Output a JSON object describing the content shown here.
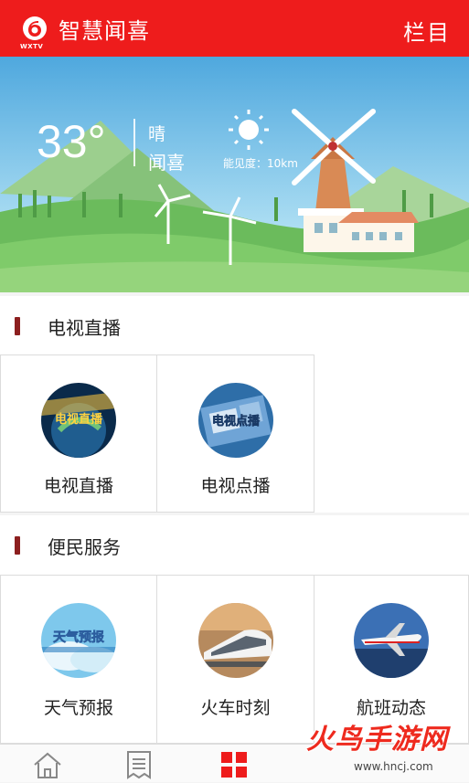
{
  "header": {
    "logo_caption": "WXTV",
    "title": "智慧闻喜",
    "menu_label": "栏目"
  },
  "weather": {
    "temperature": "33°",
    "condition": "晴",
    "city": "闻喜",
    "visibility": "能见度：10km"
  },
  "sections": [
    {
      "title": "电视直播",
      "tiles": [
        {
          "label": "电视直播",
          "icon_text": "电视直播",
          "icon": "tv-live-icon"
        },
        {
          "label": "电视点播",
          "icon_text": "电视点播",
          "icon": "tv-vod-icon"
        }
      ]
    },
    {
      "title": "便民服务",
      "tiles": [
        {
          "label": "天气预报",
          "icon_text": "天气预报",
          "icon": "weather-forecast-icon"
        },
        {
          "label": "火车时刻",
          "icon": "train-icon"
        },
        {
          "label": "航班动态",
          "icon": "airplane-icon"
        }
      ]
    }
  ],
  "bottom_nav": [
    {
      "name": "home",
      "icon": "home-icon",
      "active": false
    },
    {
      "name": "news",
      "icon": "list-icon",
      "active": false
    },
    {
      "name": "apps",
      "icon": "grid-icon",
      "active": true
    }
  ],
  "watermark": {
    "text": "火鸟手游网",
    "url": "www.hncj.com"
  },
  "colors": {
    "brand_red": "#ee1c1c",
    "section_marker": "#8c1f1f",
    "sky_top": "#5fb8e6",
    "grass": "#7cc36a"
  }
}
